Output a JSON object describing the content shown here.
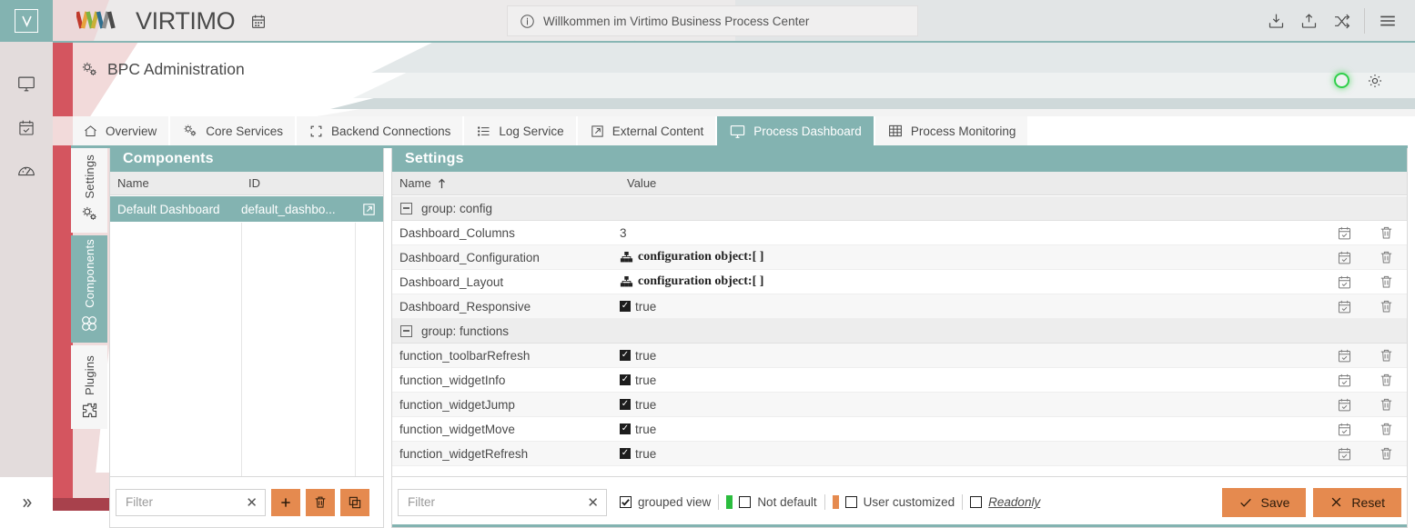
{
  "brand": {
    "name": "VIRTIMO",
    "calendar_icon": "calendar-icon"
  },
  "topbar": {
    "welcome_message": "Willkommen im Virtimo Business Process Center",
    "info_icon": "info-icon",
    "icons": [
      "download-icon",
      "upload-icon",
      "shuffle-icon",
      "hamburger-menu-icon"
    ]
  },
  "rail": {
    "logo_icon": "virtimo-mark-icon",
    "items": [
      {
        "icon": "monitor-icon",
        "name": "monitor"
      },
      {
        "icon": "calendar-check-icon",
        "name": "tasks"
      },
      {
        "icon": "gauge-icon",
        "name": "dashboard"
      }
    ],
    "expand_icon": "double-chevron-right-icon"
  },
  "header": {
    "title": "BPC Administration",
    "title_icon": "gears-icon",
    "status_icon": "status-online-indicator",
    "status_color": "#2fcf4a",
    "settings_icon": "gear-icon"
  },
  "tabs": [
    {
      "label": "Overview",
      "icon": "home-icon",
      "active": false
    },
    {
      "label": "Core Services",
      "icon": "gears-icon",
      "active": false
    },
    {
      "label": "Backend Connections",
      "icon": "brackets-icon",
      "active": false
    },
    {
      "label": "Log Service",
      "icon": "list-icon",
      "active": false
    },
    {
      "label": "External Content",
      "icon": "external-link-icon",
      "active": false
    },
    {
      "label": "Process Dashboard",
      "icon": "monitor-icon",
      "active": true
    },
    {
      "label": "Process Monitoring",
      "icon": "table-grid-icon",
      "active": false
    }
  ],
  "vertical_tabs": [
    {
      "label": "Settings",
      "icon": "gears-icon",
      "active": false
    },
    {
      "label": "Components",
      "icon": "components-icon",
      "active": true
    },
    {
      "label": "Plugins",
      "icon": "puzzle-piece-icon",
      "active": false
    }
  ],
  "components_panel": {
    "title": "Components",
    "columns": [
      "Name",
      "ID"
    ],
    "rows": [
      {
        "name": "Default Dashboard",
        "id": "default_dashbo...",
        "action_icon": "open-external-icon",
        "selected": true
      }
    ],
    "toolbar": {
      "filter_placeholder": "Filter",
      "clear_icon": "clear-x-icon",
      "add_icon": "plus-icon",
      "delete_icon": "trash-icon",
      "copy_icon": "copy-icon"
    }
  },
  "settings_panel": {
    "title": "Settings",
    "columns": [
      {
        "label": "Name",
        "sort_icon": "sort-ascending-arrow"
      },
      {
        "label": "Value"
      }
    ],
    "rows": [
      {
        "type": "group",
        "name": "group: config",
        "collapse_icon": "minus-box-icon"
      },
      {
        "type": "setting",
        "name": "Dashboard_Columns",
        "value": "3",
        "value_type": "text",
        "edit_icon": "calendar-check-icon",
        "delete_icon": "trash-icon"
      },
      {
        "type": "setting",
        "name": "Dashboard_Configuration",
        "value": "configuration object:[ ]",
        "value_type": "object",
        "value_icon": "hierarchy-icon",
        "edit_icon": "calendar-check-icon",
        "delete_icon": "trash-icon"
      },
      {
        "type": "setting",
        "name": "Dashboard_Layout",
        "value": "configuration object:[ ]",
        "value_type": "object",
        "value_icon": "hierarchy-icon",
        "edit_icon": "calendar-check-icon",
        "delete_icon": "trash-icon"
      },
      {
        "type": "setting",
        "name": "Dashboard_Responsive",
        "value": "true",
        "value_type": "boolean",
        "edit_icon": "calendar-check-icon",
        "delete_icon": "trash-icon"
      },
      {
        "type": "group",
        "name": "group: functions",
        "collapse_icon": "minus-box-icon"
      },
      {
        "type": "setting",
        "name": "function_toolbarRefresh",
        "value": "true",
        "value_type": "boolean",
        "edit_icon": "calendar-check-icon",
        "delete_icon": "trash-icon"
      },
      {
        "type": "setting",
        "name": "function_widgetInfo",
        "value": "true",
        "value_type": "boolean",
        "edit_icon": "calendar-check-icon",
        "delete_icon": "trash-icon"
      },
      {
        "type": "setting",
        "name": "function_widgetJump",
        "value": "true",
        "value_type": "boolean",
        "edit_icon": "calendar-check-icon",
        "delete_icon": "trash-icon"
      },
      {
        "type": "setting",
        "name": "function_widgetMove",
        "value": "true",
        "value_type": "boolean",
        "edit_icon": "calendar-check-icon",
        "delete_icon": "trash-icon"
      },
      {
        "type": "setting",
        "name": "function_widgetRefresh",
        "value": "true",
        "value_type": "boolean",
        "edit_icon": "calendar-check-icon",
        "delete_icon": "trash-icon"
      }
    ],
    "toolbar": {
      "filter_placeholder": "Filter",
      "clear_icon": "clear-x-icon",
      "checkboxes": [
        {
          "label": "grouped view",
          "checked": true,
          "swatch": null
        },
        {
          "label": "Not default",
          "checked": false,
          "swatch": "#2bbd3e"
        },
        {
          "label": "User customized",
          "checked": false,
          "swatch": "#e58a4f"
        },
        {
          "label": "Readonly",
          "checked": false,
          "swatch": null,
          "style": "readonly"
        }
      ],
      "save_label": "Save",
      "save_icon": "check-icon",
      "reset_label": "Reset",
      "reset_icon": "x-icon"
    }
  },
  "colors": {
    "teal": "#83b3b1",
    "orange": "#e58a4f",
    "red": "#d4555f",
    "green": "#2bbd3e"
  }
}
